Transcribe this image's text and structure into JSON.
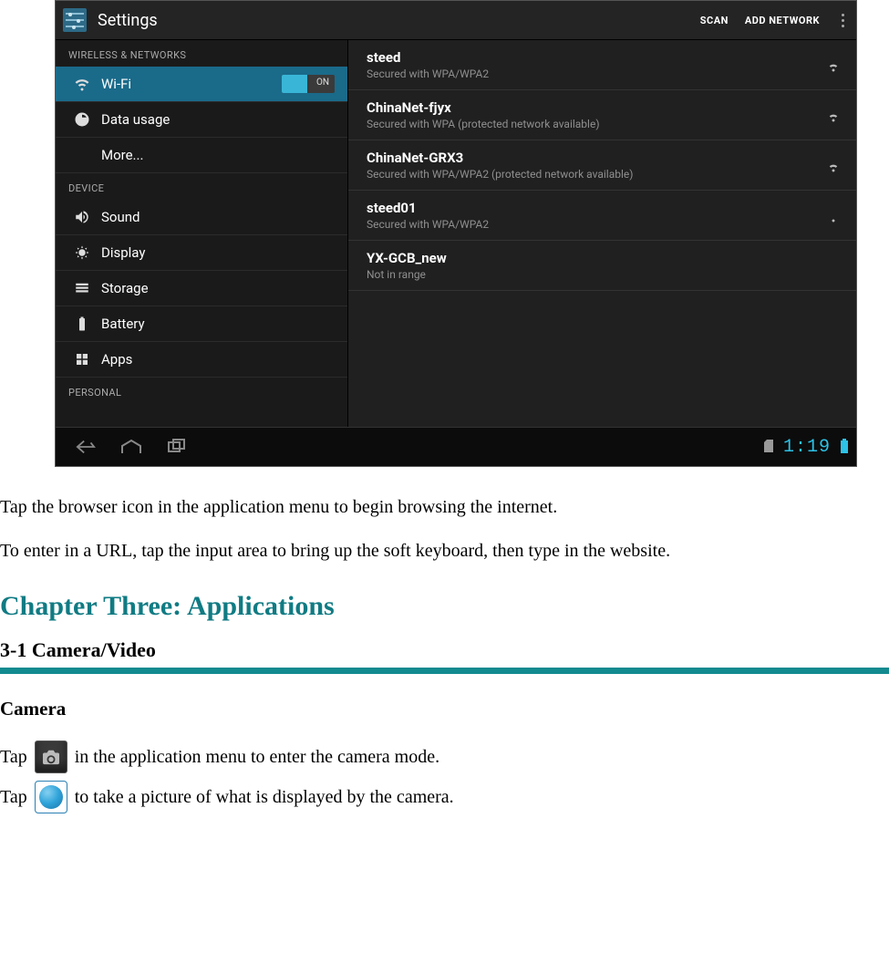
{
  "screenshot": {
    "header": {
      "title": "Settings",
      "scan": "SCAN",
      "add_network": "ADD NETWORK"
    },
    "sections": {
      "wireless": "WIRELESS & NETWORKS",
      "device": "DEVICE",
      "personal": "PERSONAL"
    },
    "nav": {
      "wifi": "Wi-Fi",
      "wifi_toggle": "ON",
      "data_usage": "Data usage",
      "more": "More...",
      "sound": "Sound",
      "display": "Display",
      "storage": "Storage",
      "battery": "Battery",
      "apps": "Apps"
    },
    "networks": [
      {
        "ssid": "steed",
        "sub": "Secured with WPA/WPA2",
        "signal": true
      },
      {
        "ssid": "ChinaNet-fjyx",
        "sub": "Secured with WPA (protected network available)",
        "signal": true
      },
      {
        "ssid": "ChinaNet-GRX3",
        "sub": "Secured with WPA/WPA2 (protected network available)",
        "signal": true
      },
      {
        "ssid": "steed01",
        "sub": "Secured with WPA/WPA2",
        "signal": true
      },
      {
        "ssid": "YX-GCB_new",
        "sub": "Not in range",
        "signal": false
      }
    ],
    "status_bar": {
      "time": "1:19"
    }
  },
  "doc": {
    "p1": "Tap the browser icon in the application menu to begin browsing the internet.",
    "p2": "To enter in a URL, tap the input area to bring up the soft keyboard, then type in the website.",
    "chapter": "Chapter Three: Applications",
    "section": "3-1 Camera/Video",
    "camera_hdr": "Camera",
    "tap_prefix": "Tap",
    "cam_line_rest": " in the application menu to enter the camera mode.",
    "shutter_line_rest": " to take a picture of what is displayed by the camera."
  },
  "colors": {
    "teal": "#128a8f",
    "heading": "#107b83",
    "clock": "#2dc2e6"
  }
}
